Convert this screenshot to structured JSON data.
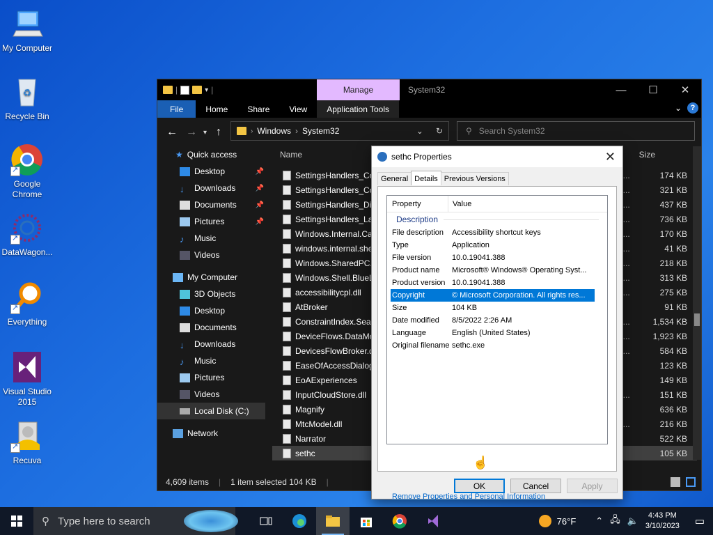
{
  "desktop": {
    "icons": [
      {
        "label": "My Computer"
      },
      {
        "label": "Recycle Bin"
      },
      {
        "label": "Google Chrome"
      },
      {
        "label": "DataWagon..."
      },
      {
        "label": "Everything"
      },
      {
        "label": "Visual Studio 2015"
      },
      {
        "label": "Recuva"
      }
    ]
  },
  "explorer": {
    "manage_tab": "Manage",
    "title": "System32",
    "ribbon": {
      "file": "File",
      "home": "Home",
      "share": "Share",
      "view": "View",
      "app_tools": "Application Tools"
    },
    "address": {
      "crumb1": "Windows",
      "crumb2": "System32"
    },
    "search_placeholder": "Search System32",
    "nav": {
      "quick_access": "Quick access",
      "qa_items": [
        "Desktop",
        "Downloads",
        "Documents",
        "Pictures",
        "Music",
        "Videos"
      ],
      "my_computer": "My Computer",
      "pc_items": [
        "3D Objects",
        "Desktop",
        "Documents",
        "Downloads",
        "Music",
        "Pictures",
        "Videos",
        "Local Disk (C:)"
      ],
      "network": "Network"
    },
    "columns": {
      "name": "Name",
      "size": "Size"
    },
    "files": [
      {
        "name": "SettingsHandlers_Co",
        "trunc": "n...",
        "size": "174 KB"
      },
      {
        "name": "SettingsHandlers_Co",
        "trunc": "n...",
        "size": "321 KB"
      },
      {
        "name": "SettingsHandlers_Dis",
        "trunc": "n...",
        "size": "437 KB"
      },
      {
        "name": "SettingsHandlers_Lar",
        "trunc": "n...",
        "size": "736 KB"
      },
      {
        "name": "Windows.Internal.Ca",
        "trunc": "n...",
        "size": "170 KB"
      },
      {
        "name": "windows.internal.she",
        "trunc": "n...",
        "size": "41 KB"
      },
      {
        "name": "Windows.SharedPC.A",
        "trunc": "n...",
        "size": "218 KB"
      },
      {
        "name": "Windows.Shell.BlueL",
        "trunc": "n...",
        "size": "313 KB"
      },
      {
        "name": "accessibilitycpl.dll",
        "trunc": "n...",
        "size": "275 KB"
      },
      {
        "name": "AtBroker",
        "trunc": "",
        "size": "91 KB"
      },
      {
        "name": "ConstraintIndex.Sear",
        "trunc": "n...",
        "size": "1,534 KB"
      },
      {
        "name": "DeviceFlows.DataMo",
        "trunc": "n...",
        "size": "1,923 KB"
      },
      {
        "name": "DevicesFlowBroker.d",
        "trunc": "n...",
        "size": "584 KB"
      },
      {
        "name": "EaseOfAccessDialog",
        "trunc": "",
        "size": "123 KB"
      },
      {
        "name": "EoAExperiences",
        "trunc": "",
        "size": "149 KB"
      },
      {
        "name": "InputCloudStore.dll",
        "trunc": "n...",
        "size": "151 KB"
      },
      {
        "name": "Magnify",
        "trunc": "",
        "size": "636 KB"
      },
      {
        "name": "MtcModel.dll",
        "trunc": "n...",
        "size": "216 KB"
      },
      {
        "name": "Narrator",
        "trunc": "",
        "size": "522 KB"
      },
      {
        "name": "sethc",
        "trunc": "",
        "size": "105 KB"
      }
    ],
    "status": {
      "count": "4,609 items",
      "selected": "1 item selected  104 KB"
    }
  },
  "dialog": {
    "title": "sethc Properties",
    "tabs": {
      "general": "General",
      "details": "Details",
      "previous": "Previous Versions"
    },
    "head": {
      "property": "Property",
      "value": "Value"
    },
    "group": "Description",
    "rows": [
      {
        "k": "File description",
        "v": "Accessibility shortcut keys"
      },
      {
        "k": "Type",
        "v": "Application"
      },
      {
        "k": "File version",
        "v": "10.0.19041.388"
      },
      {
        "k": "Product name",
        "v": "Microsoft® Windows® Operating Syst..."
      },
      {
        "k": "Product version",
        "v": "10.0.19041.388"
      },
      {
        "k": "Copyright",
        "v": "© Microsoft Corporation. All rights res..."
      },
      {
        "k": "Size",
        "v": "104 KB"
      },
      {
        "k": "Date modified",
        "v": "8/5/2022 2:26 AM"
      },
      {
        "k": "Language",
        "v": "English (United States)"
      },
      {
        "k": "Original filename",
        "v": "sethc.exe"
      }
    ],
    "remove_link": "Remove Properties and Personal Information",
    "ok": "OK",
    "cancel": "Cancel",
    "apply": "Apply"
  },
  "taskbar": {
    "search_placeholder": "Type here to search",
    "weather": "76°F",
    "time": "4:43 PM",
    "date": "3/10/2023"
  },
  "colors": {
    "accent": "#0078d7",
    "manage_tab": "#e3b9ff",
    "file_tab": "#1a5fb4"
  }
}
